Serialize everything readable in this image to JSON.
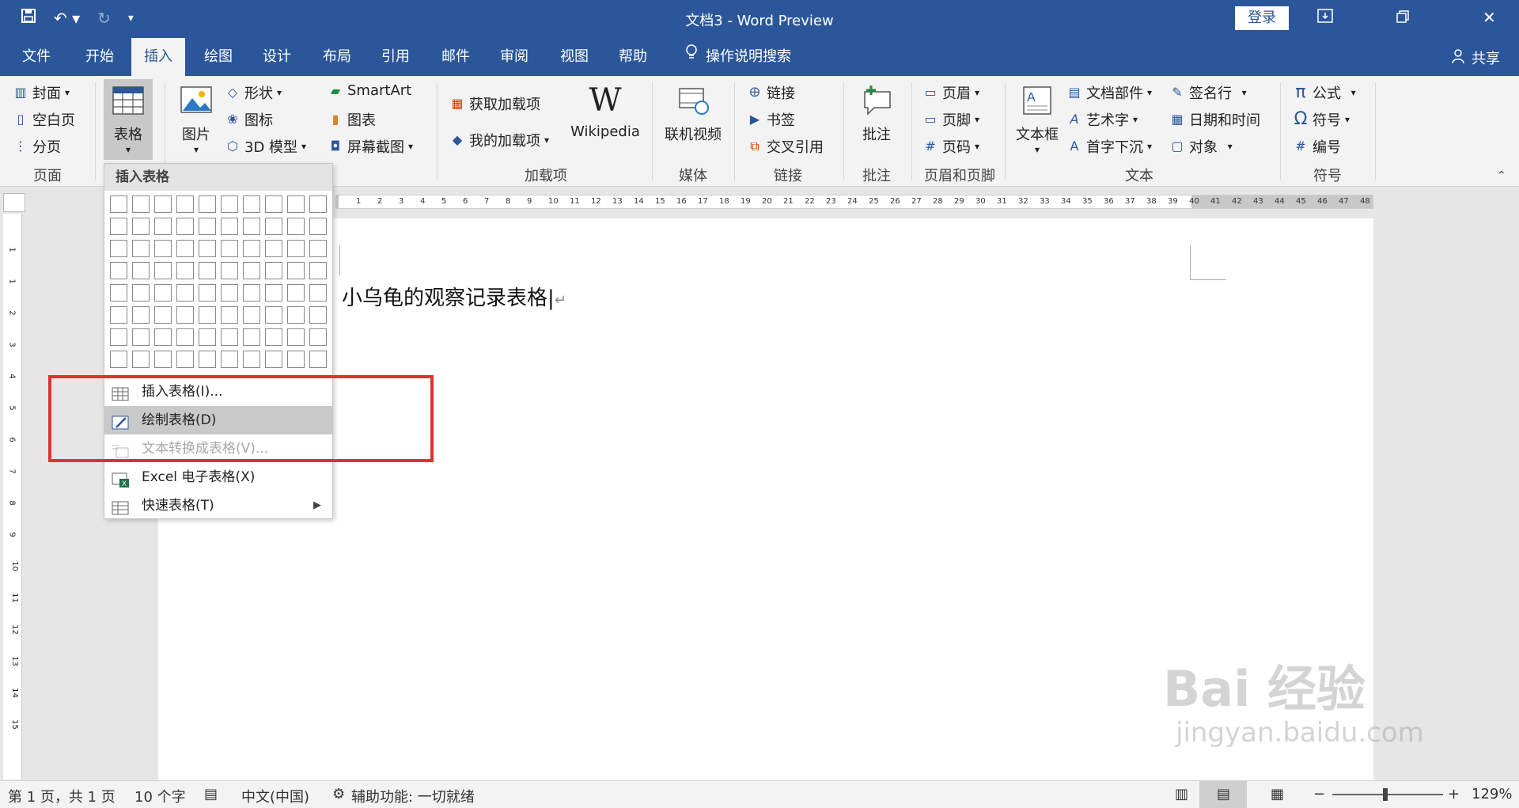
{
  "window": {
    "title": "文档3 - Word Preview",
    "login_label": "登录",
    "share_label": "共享"
  },
  "tabs": [
    "文件",
    "开始",
    "插入",
    "绘图",
    "设计",
    "布局",
    "引用",
    "邮件",
    "审阅",
    "视图",
    "帮助"
  ],
  "active_tab": "插入",
  "tell_me": "操作说明搜索",
  "ribbon": {
    "pages": {
      "items": [
        "封面",
        "空白页",
        "分页"
      ],
      "group": "页面"
    },
    "table": {
      "label": "表格"
    },
    "illustrations": {
      "picture": "图片",
      "shapes": "形状",
      "icons": "图标",
      "model3d": "3D 模型",
      "smartart": "SmartArt",
      "chart": "图表",
      "screenshot": "屏幕截图"
    },
    "addins": {
      "get": "获取加载项",
      "my": "我的加载项",
      "wikipedia": "Wikipedia",
      "group": "加载项"
    },
    "media": {
      "video": "联机视频",
      "group": "媒体"
    },
    "links": {
      "link": "链接",
      "bookmark": "书签",
      "crossref": "交叉引用",
      "group": "链接"
    },
    "comments": {
      "comment": "批注",
      "group": "批注"
    },
    "headerfooter": {
      "header": "页眉",
      "footer": "页脚",
      "pagenum": "页码",
      "group": "页眉和页脚"
    },
    "text": {
      "textbox": "文本框",
      "parts": "文档部件",
      "wordart": "艺术字",
      "dropcap": "首字下沉",
      "sigline": "签名行",
      "datetime": "日期和时间",
      "object": "对象",
      "group": "文本"
    },
    "symbols": {
      "equation": "公式",
      "symbol": "符号",
      "number": "编号",
      "group": "符号"
    }
  },
  "dropdown": {
    "header": "插入表格",
    "items": [
      {
        "label": "插入表格(I)...",
        "state": "normal"
      },
      {
        "label": "绘制表格(D)",
        "state": "highlighted"
      },
      {
        "label": "文本转换成表格(V)...",
        "state": "disabled"
      },
      {
        "label": "Excel 电子表格(X)",
        "state": "normal"
      },
      {
        "label": "快速表格(T)",
        "state": "normal"
      }
    ]
  },
  "document": {
    "text": "小乌龟的观察记录表格"
  },
  "ruler": {
    "h_ticks": [
      "1",
      "2",
      "3",
      "4",
      "5",
      "6",
      "7",
      "8",
      "9",
      "10",
      "11",
      "12",
      "13",
      "14",
      "15",
      "16",
      "17",
      "18",
      "19",
      "20",
      "21",
      "22",
      "23",
      "24",
      "25",
      "26",
      "27",
      "28",
      "29",
      "30",
      "31",
      "32",
      "33",
      "34",
      "35",
      "36",
      "37",
      "38",
      "39",
      "40",
      "41",
      "42",
      "43",
      "44",
      "45",
      "46",
      "47",
      "48"
    ],
    "v_ticks": [
      "1",
      "1",
      "2",
      "3",
      "4",
      "5",
      "6",
      "7",
      "8",
      "9",
      "10",
      "11",
      "12",
      "13",
      "14",
      "15"
    ]
  },
  "status": {
    "page": "第 1 页，共 1 页",
    "words": "10 个字",
    "language": "中文(中国)",
    "accessibility": "辅助功能: 一切就绪",
    "zoom": "129%"
  },
  "watermark": {
    "brand": "Bai 经验",
    "site": "jingyan.baidu.com"
  },
  "colors": {
    "brand": "#2b579a",
    "highlight": "#c9c9c9",
    "annotation": "#e03131"
  }
}
